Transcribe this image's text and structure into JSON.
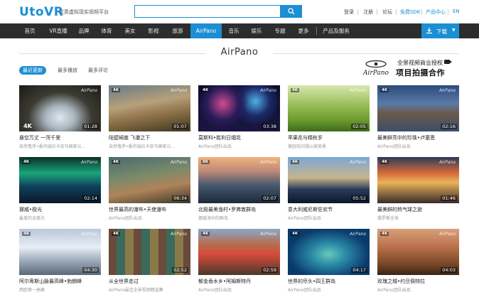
{
  "header": {
    "logo": "UtoVR",
    "slogan": "优质虚拟现实视频平台",
    "links": [
      "登录",
      "注册",
      "论坛",
      "免费SDK",
      "产品中心",
      "EN"
    ]
  },
  "nav": {
    "items": [
      "首页",
      "VR直播",
      "品牌",
      "体育",
      "美女",
      "影视",
      "旅游",
      "AirPano",
      "音乐",
      "娱乐",
      "专题",
      "更多",
      "产品及服务"
    ],
    "active": "AirPano",
    "download": "下载"
  },
  "section": {
    "title": "AirPano",
    "tabs": [
      "最近更新",
      "最多播放",
      "最多评论"
    ],
    "banner_logo": "AirPano",
    "banner_line1": "全景视频商业授权",
    "banner_line2": "项目拍摄合作"
  },
  "colors": {
    "accent": "#1c8ed4",
    "nav_bg": "#2d2d2d"
  },
  "videos": [
    {
      "title": "悬空万丈 一泻千里",
      "sub": "自然鬼斧•委内瑞拉卡奈马国家公...",
      "dur": "01:28",
      "badge": "4K",
      "wm": "AirPano"
    },
    {
      "title": "陆壁崎崖 飞瀑之下",
      "sub": "自然鬼斧•委内瑞拉卡奈马国家公...",
      "dur": "01:07",
      "badge": "4K",
      "wm": "AirPano"
    },
    {
      "title": "莫斯科•胜利日烟花",
      "sub": "AirPano团队出品",
      "dur": "03:38",
      "badge": "4K",
      "wm": "AirPano"
    },
    {
      "title": "苹果花与精秋岁",
      "sub": "果园花间漫山坡美景",
      "dur": "02:05",
      "badge": "4K",
      "wm": "AirPano"
    },
    {
      "title": "最美鲜亮中的珍珠•卢塞恩",
      "sub": "AirPano团队出品",
      "dur": "02:16",
      "badge": "4K",
      "wm": "AirPano"
    },
    {
      "title": "挪威•极光",
      "sub": "最美的北极光",
      "dur": "02:14",
      "badge": "4K",
      "wm": "AirPano"
    },
    {
      "title": "世界最高的瀑布•天使瀑布",
      "sub": "AirPano团队出品",
      "dur": "06:34",
      "badge": "4K",
      "wm": "AirPano"
    },
    {
      "title": "北极最美渔村•罗弗敦群岛",
      "sub": "挪威海中的群岛",
      "dur": "02:07",
      "badge": "8K",
      "wm": "AirPano"
    },
    {
      "title": "意大利威尼斯狂欢节",
      "sub": "AirPano团队出品",
      "dur": "05:52",
      "badge": "4K",
      "wm": "AirPano"
    },
    {
      "title": "最美鲜的热气球之旅",
      "sub": "俄罗斯全体",
      "dur": "01:46",
      "badge": "4K",
      "wm": "AirPano"
    },
    {
      "title": "阿尔卑斯山脉最高峰•勃朗峰",
      "sub": "西欧第一高峰",
      "dur": "04:30",
      "badge": "4K",
      "wm": "AirPano"
    },
    {
      "title": "从全世界走过",
      "sub": "AirPano最佳全景视频精选集",
      "dur": "02:52",
      "badge": "4K",
      "wm": "AirPano"
    },
    {
      "title": "郁金香水乡•阿姆斯特丹",
      "sub": "AirPano团队出品",
      "dur": "02:59",
      "badge": "4K",
      "wm": "AirPano"
    },
    {
      "title": "世界的尽头•四王群岛",
      "sub": "AirPano团队出品",
      "dur": "04:17",
      "badge": "4K",
      "wm": "AirPano"
    },
    {
      "title": "玫瑰之城•约旦佩特拉",
      "sub": "AirPano团队出品",
      "dur": "04:03",
      "badge": "4K",
      "wm": "AirPano"
    }
  ]
}
